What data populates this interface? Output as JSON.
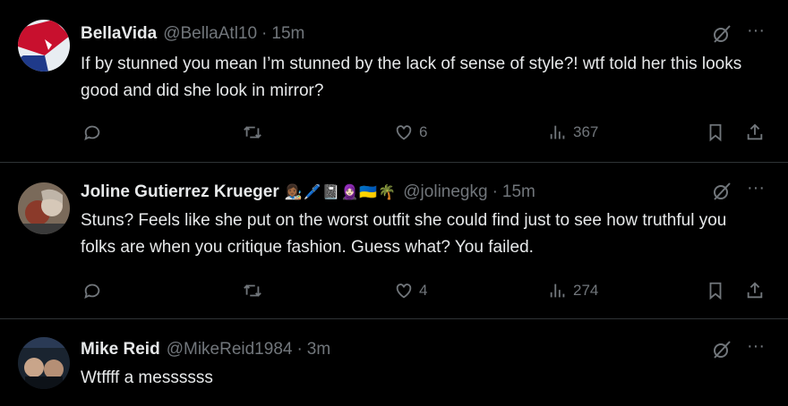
{
  "tweets": [
    {
      "name": "BellaVida",
      "emojis": "",
      "handle": "@BellaAtl10",
      "time": "15m",
      "text": "If by stunned you mean I’m stunned by the lack of sense of style?! wtf told her this looks good and did she look in mirror?",
      "replies": "",
      "retweets": "",
      "likes": "6",
      "views": "367"
    },
    {
      "name": "Joline Gutierrez Krueger",
      "emojis": "👩🏾‍🎨🖊️📓🧕🏻🇺🇦🌴",
      "handle": "@jolinegkg",
      "time": "15m",
      "text": "Stuns? Feels like she put on the worst outfit she could find just to see how truthful you folks are when you critique fashion. Guess what? You failed.",
      "replies": "",
      "retweets": "",
      "likes": "4",
      "views": "274"
    },
    {
      "name": "Mike Reid",
      "emojis": "",
      "handle": "@MikeReid1984",
      "time": "3m",
      "text": "Wtffff a messssss"
    }
  ],
  "separator": "·",
  "colors": {
    "background": "#000000",
    "text": "#e7e9ea",
    "muted": "#71767b",
    "divider": "#2f3336"
  },
  "icons": [
    "grok-icon",
    "more-icon",
    "reply-icon",
    "retweet-icon",
    "like-icon",
    "views-icon",
    "bookmark-icon",
    "share-icon"
  ]
}
